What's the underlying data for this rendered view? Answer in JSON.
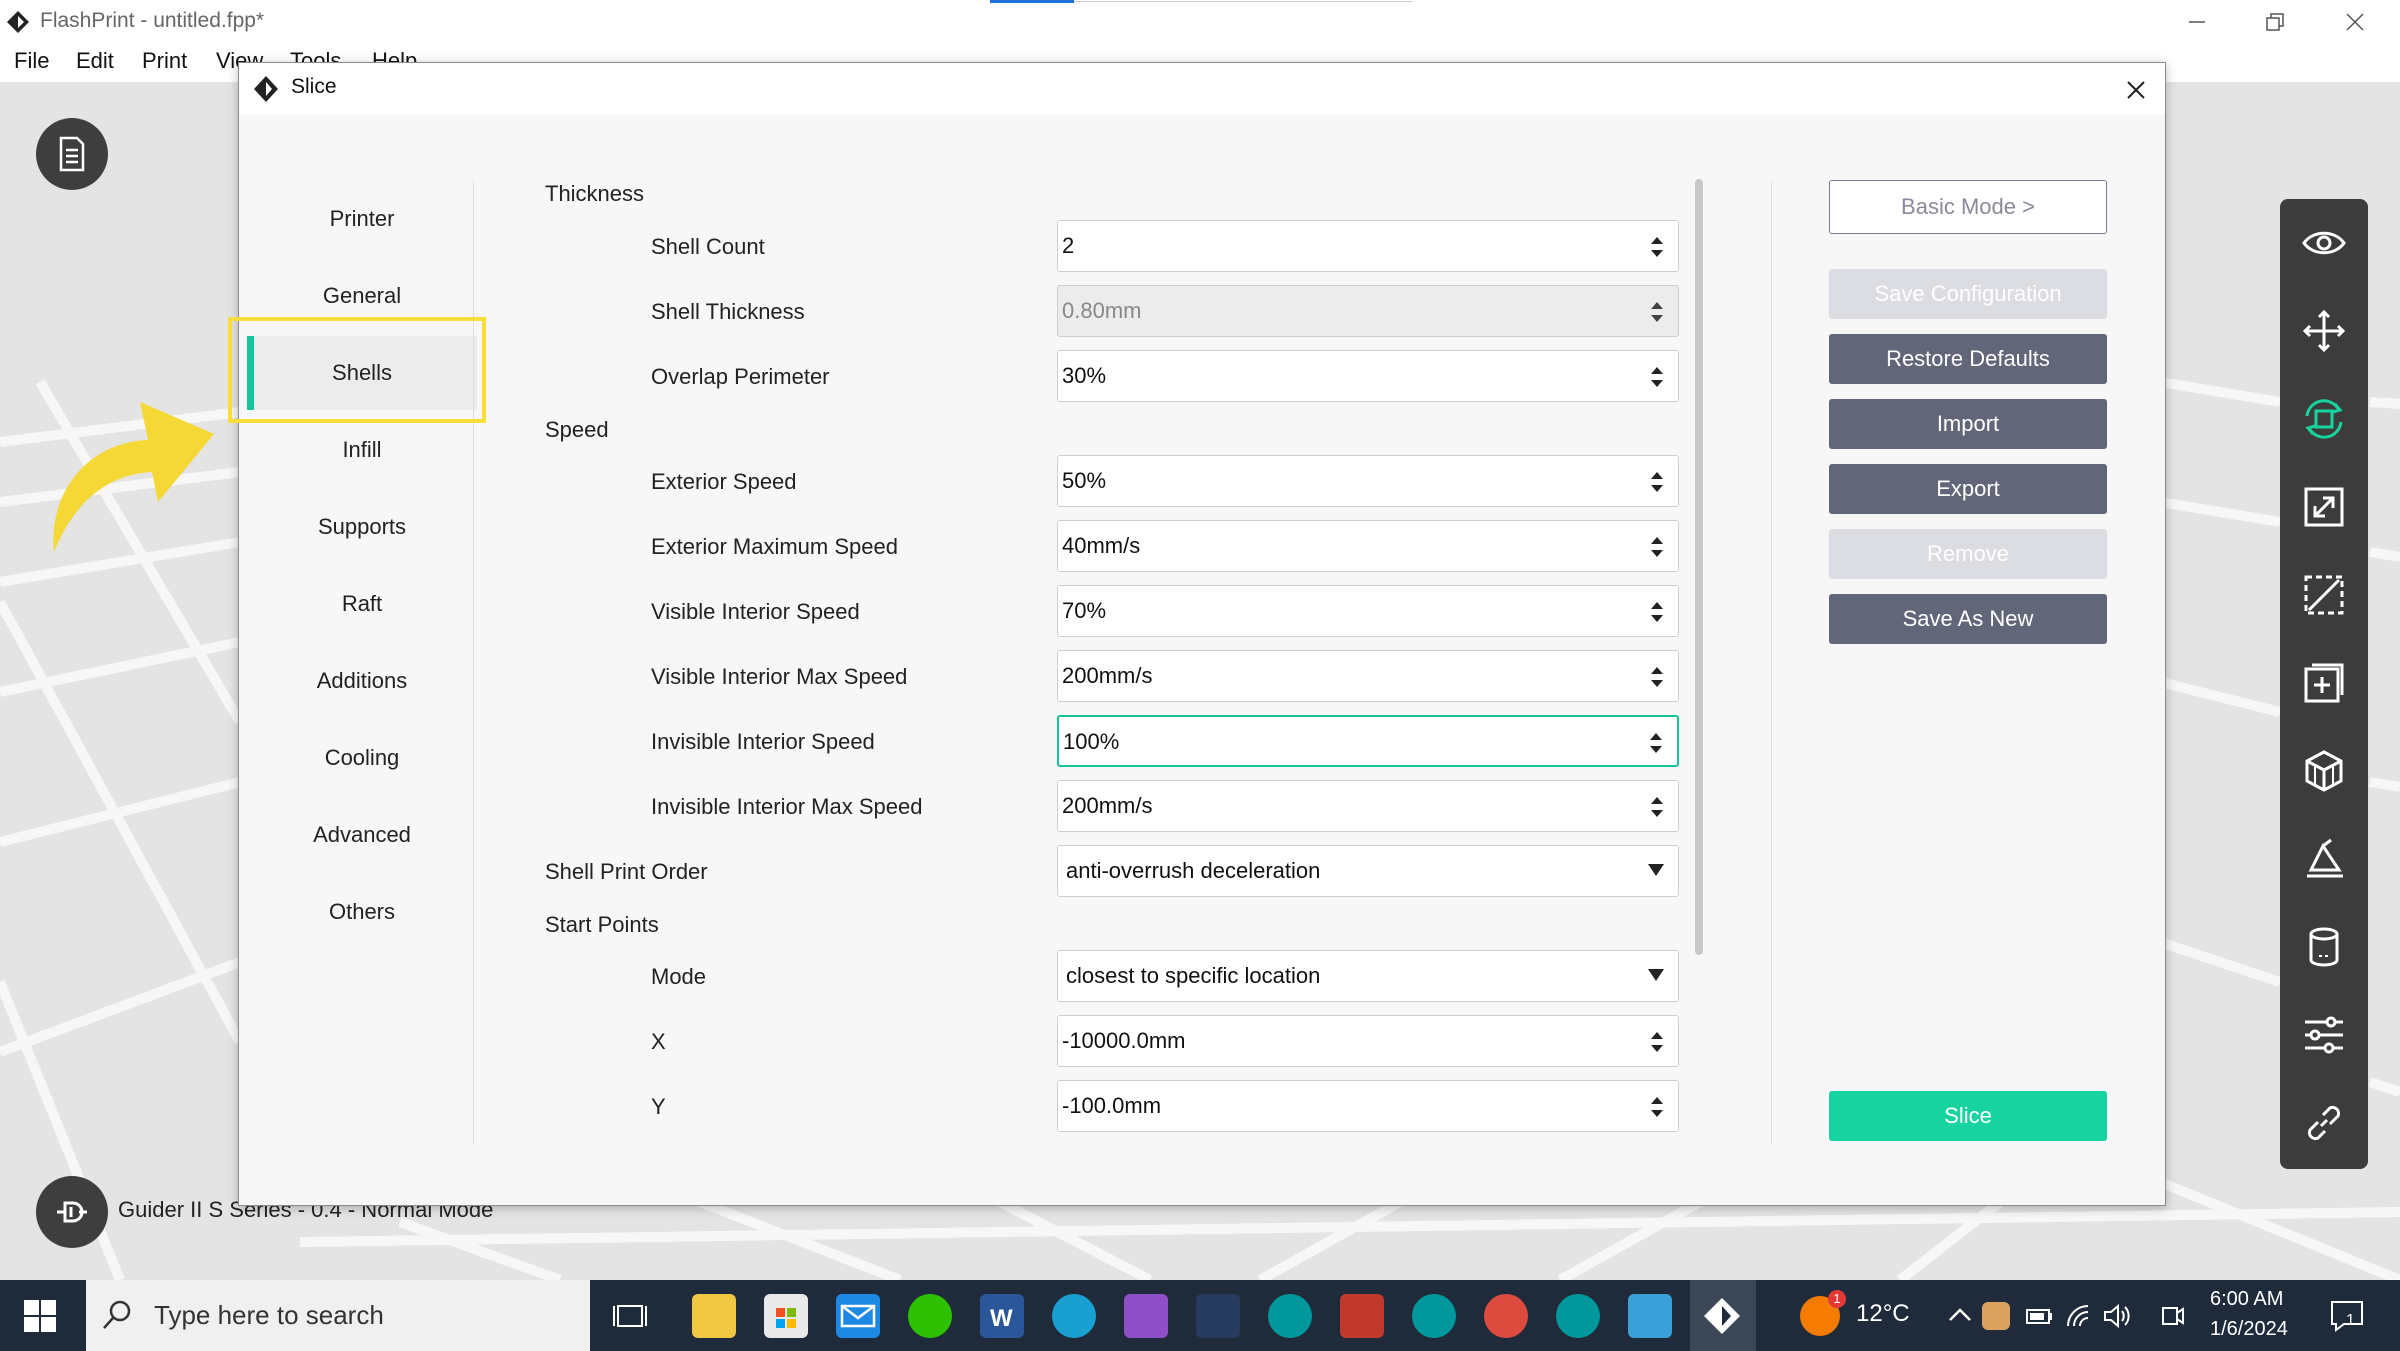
{
  "app": {
    "title": "FlashPrint - untitled.fpp*",
    "menu": [
      "File",
      "Edit",
      "Print",
      "View",
      "Tools",
      "Help"
    ]
  },
  "viewport": {
    "machine_status": "Guider II S Series - 0.4 - Normal Mode"
  },
  "dialog": {
    "title": "Slice",
    "nav": [
      "Printer",
      "General",
      "Shells",
      "Infill",
      "Supports",
      "Raft",
      "Additions",
      "Cooling",
      "Advanced",
      "Others"
    ],
    "active_nav": "Shells",
    "sections": {
      "thickness": "Thickness",
      "speed": "Speed",
      "shell_print_order": "Shell Print Order",
      "start_points": "Start Points"
    },
    "fields": {
      "shell_count": {
        "label": "Shell Count",
        "value": "2"
      },
      "shell_thickness": {
        "label": "Shell Thickness",
        "value": "0.80mm"
      },
      "overlap_perimeter": {
        "label": "Overlap Perimeter",
        "value": "30%"
      },
      "exterior_speed": {
        "label": "Exterior Speed",
        "value": "50%"
      },
      "exterior_max_speed": {
        "label": "Exterior Maximum Speed",
        "value": "40mm/s"
      },
      "visible_interior_speed": {
        "label": "Visible Interior Speed",
        "value": "70%"
      },
      "visible_interior_max_speed": {
        "label": "Visible Interior Max Speed",
        "value": "200mm/s"
      },
      "invisible_interior_speed": {
        "label": "Invisible Interior Speed",
        "value": "100%"
      },
      "invisible_interior_max_speed": {
        "label": "Invisible Interior Max Speed",
        "value": "200mm/s"
      },
      "shell_print_order": {
        "value": "anti-overrush deceleration"
      },
      "mode": {
        "label": "Mode",
        "value": "closest to specific location"
      },
      "x": {
        "label": "X",
        "value": "-10000.0mm"
      },
      "y": {
        "label": "Y",
        "value": "-100.0mm"
      }
    },
    "buttons": {
      "basic_mode": "Basic Mode >",
      "save_configuration": "Save Configuration",
      "restore_defaults": "Restore Defaults",
      "import": "Import",
      "export": "Export",
      "remove": "Remove",
      "save_as_new": "Save As New",
      "slice": "Slice"
    }
  },
  "taskbar": {
    "search_placeholder": "Type here to search",
    "weather_temp": "12°C",
    "weather_badge": "1",
    "time": "6:00 AM",
    "date": "1/6/2024",
    "notification_count": "1"
  },
  "colors": {
    "accent": "#17d39f",
    "dark_button": "#616678",
    "highlight": "#f7de3a",
    "toolbar": "#3c3c3c",
    "taskbar": "#1f2b3a"
  }
}
